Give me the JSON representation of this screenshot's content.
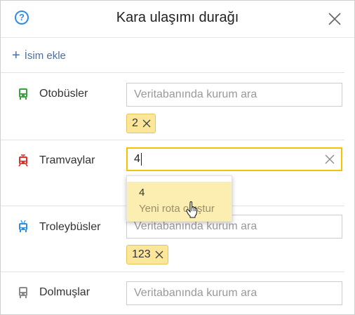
{
  "dialog": {
    "title": "Kara ulaşımı durağı",
    "help_icon": "?"
  },
  "add_name": {
    "label": "İsim ekle"
  },
  "rows": {
    "buses": {
      "label": "Otobüsler",
      "placeholder": "Veritabanında kurum ara",
      "chips": [
        "2"
      ],
      "icon": "bus-icon",
      "color": "#3aa23a"
    },
    "trams": {
      "label": "Tramvaylar",
      "value": "4",
      "icon": "tram-icon",
      "color": "#e0302a"
    },
    "trolleybuses": {
      "label": "Troleybüsler",
      "placeholder": "Veritabanında kurum ara",
      "chips": [
        "123"
      ],
      "icon": "trolleybus-icon",
      "color": "#2e8ee6"
    },
    "minibuses": {
      "label": "Dolmuşlar",
      "placeholder": "Veritabanında kurum ara",
      "icon": "minibus-icon",
      "color": "#8a8a8a"
    }
  },
  "suggestion": {
    "value": "4",
    "action": "Yeni rota oluştur"
  },
  "colors": {
    "accent": "#f2c400",
    "chip_bg": "#fbe69a",
    "link": "#4d6ea5"
  }
}
